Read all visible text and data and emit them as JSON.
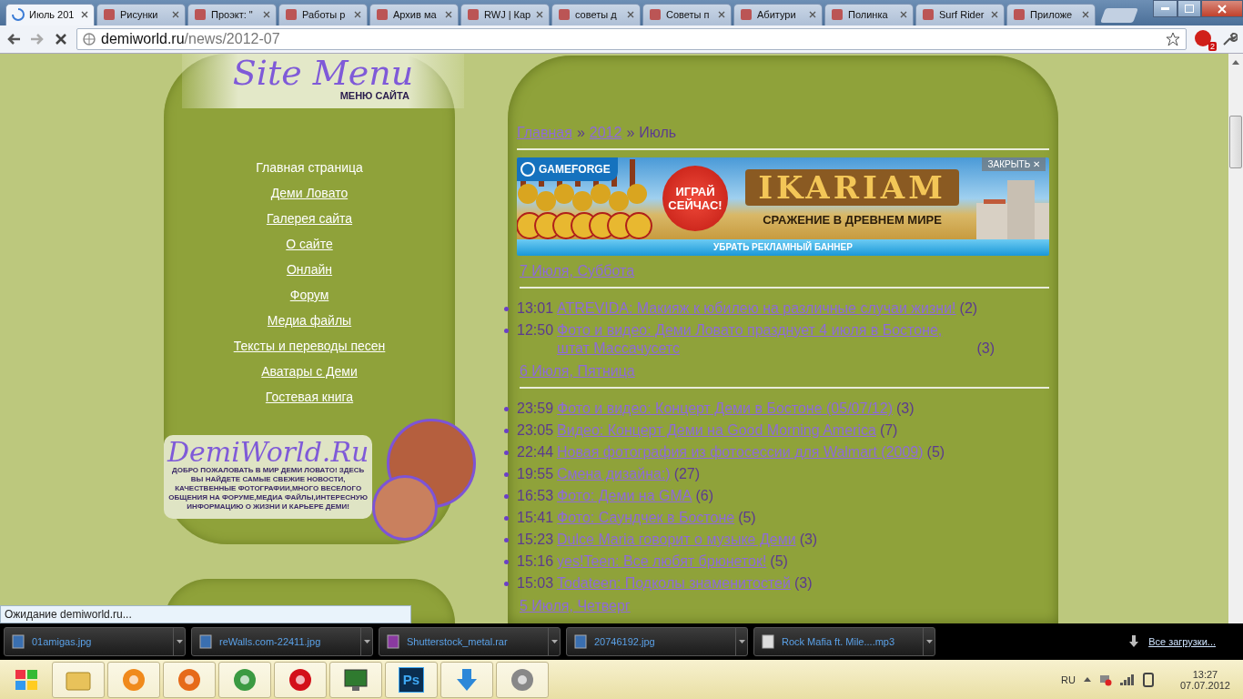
{
  "tabs": [
    {
      "title": "Июль 201",
      "selected": true
    },
    {
      "title": "Рисунки",
      "selected": false
    },
    {
      "title": "Проэкт: \"",
      "selected": false
    },
    {
      "title": "Работы р",
      "selected": false
    },
    {
      "title": "Архив ма",
      "selected": false
    },
    {
      "title": "RWJ | Кар",
      "selected": false
    },
    {
      "title": "советы д",
      "selected": false
    },
    {
      "title": "Советы п",
      "selected": false
    },
    {
      "title": "Абитури",
      "selected": false
    },
    {
      "title": "Полинка",
      "selected": false
    },
    {
      "title": "Surf Rider",
      "selected": false
    },
    {
      "title": "Приложе",
      "selected": false
    }
  ],
  "address": {
    "host": "demiworld.ru",
    "path": "/news/2012-07"
  },
  "extension_badge": "2",
  "site_menu": {
    "title": "Site Menu",
    "subtitle": "МЕНЮ САЙТА",
    "items": [
      {
        "label": "Главная страница",
        "selected": true
      },
      {
        "label": "Деми Ловато",
        "selected": false
      },
      {
        "label": "Галерея сайта",
        "selected": false
      },
      {
        "label": "О сайте",
        "selected": false
      },
      {
        "label": "Онлайн",
        "selected": false
      },
      {
        "label": "Форум",
        "selected": false
      },
      {
        "label": "Медиа файлы",
        "selected": false
      },
      {
        "label": "Тексты и переводы песен",
        "selected": false
      },
      {
        "label": "Аватары с Деми",
        "selected": false
      },
      {
        "label": "Гостевая книга",
        "selected": false
      }
    ]
  },
  "welcome_banner": {
    "logo": "DemiWorld.Ru",
    "text": "ДОБРО ПОЖАЛОВАТЬ В МИР ДЕМИ ЛОВАТО! ЗДЕСЬ ВЫ НАЙДЕТЕ САМЫЕ СВЕЖИЕ НОВОСТИ, КАЧЕСТВЕННЫЕ ФОТОГРАФИИ,МНОГО ВЕСЕЛОГО ОБЩЕНИЯ НА ФОРУМЕ,МЕДИА ФАЙЛЫ,ИНТЕРЕСНУЮ ИНФОРМАЦИЮ О ЖИЗНИ И КАРЬЕРЕ ДЕМИ!"
  },
  "breadcrumbs": [
    {
      "label": "Главная",
      "link": true
    },
    {
      "label": "»",
      "link": false
    },
    {
      "label": "2012",
      "link": true
    },
    {
      "label": "»",
      "link": false
    },
    {
      "label": "Июль",
      "link": false
    }
  ],
  "ad": {
    "brand": "GAMEFORGE",
    "close": "ЗАКРЫТЬ ✕",
    "badge": "ИГРАЙ СЕЙЧАС!",
    "title": "IKARIAM",
    "subtitle": "СРАЖЕНИЕ В ДРЕВНЕМ МИРЕ",
    "remove": "УБРАТЬ РЕКЛАМНЫЙ БАННЕР"
  },
  "news_days": [
    {
      "date": "7 Июля, Суббота",
      "items": [
        {
          "time": "13:01",
          "title": "ATREVIDA: Макияж к юбилею на различные случаи жизни!",
          "count": "(2)"
        },
        {
          "time": "12:50",
          "title": "Фото и видео: Деми Ловато празднует 4 июля в Бостоне, штат Массачусетс",
          "count": "(3)"
        }
      ]
    },
    {
      "date": "6 Июля, Пятница",
      "items": [
        {
          "time": "23:59",
          "title": "Фото и видео: Концерт Деми в Бостоне (05/07/12)",
          "count": "(3)"
        },
        {
          "time": "23:05",
          "title": "Видео: Концерт Деми на Good Morning America",
          "count": "(7)"
        },
        {
          "time": "22:44",
          "title": "Новая фотография из фотосессии для Walmart (2009)",
          "count": "(5)"
        },
        {
          "time": "19:55",
          "title": "Смена дизайна:)",
          "count": "(27)"
        },
        {
          "time": "16:53",
          "title": "Фото: Деми на GMA",
          "count": "(6)"
        },
        {
          "time": "15:41",
          "title": "Фото: Саундчек в Бостоне",
          "count": "(5)"
        },
        {
          "time": "15:23",
          "title": "Dulce Maria говорит о музыке Деми",
          "count": "(3)"
        },
        {
          "time": "15:16",
          "title": "yes!Teen: Все любят брюнеток!",
          "count": "(5)"
        },
        {
          "time": "15:03",
          "title": "Todateen: Подколы знаменитостей",
          "count": "(3)"
        }
      ]
    },
    {
      "date": "5 Июля, Четверг"
    }
  ],
  "status": "Ожидание demiworld.ru...",
  "downloads": [
    {
      "name": "01amigas.jpg",
      "kind": "image"
    },
    {
      "name": "reWalls.com-22411.jpg",
      "kind": "image"
    },
    {
      "name": "Shutterstock_metal.rar",
      "kind": "archive"
    },
    {
      "name": "20746192.jpg",
      "kind": "image"
    },
    {
      "name": "Rock Mafia ft. Mile....mp3",
      "kind": "audio"
    }
  ],
  "all_downloads": "Все загрузки...",
  "taskbar": {
    "apps": [
      {
        "kind": "folder"
      },
      {
        "kind": "player"
      },
      {
        "kind": "firefox"
      },
      {
        "kind": "chrome"
      },
      {
        "kind": "opera"
      },
      {
        "kind": "monitor"
      },
      {
        "kind": "photoshop",
        "label": "Ps"
      },
      {
        "kind": "download"
      },
      {
        "kind": "recorder"
      }
    ],
    "language": "RU",
    "time": "13:27",
    "date": "07.07.2012"
  }
}
